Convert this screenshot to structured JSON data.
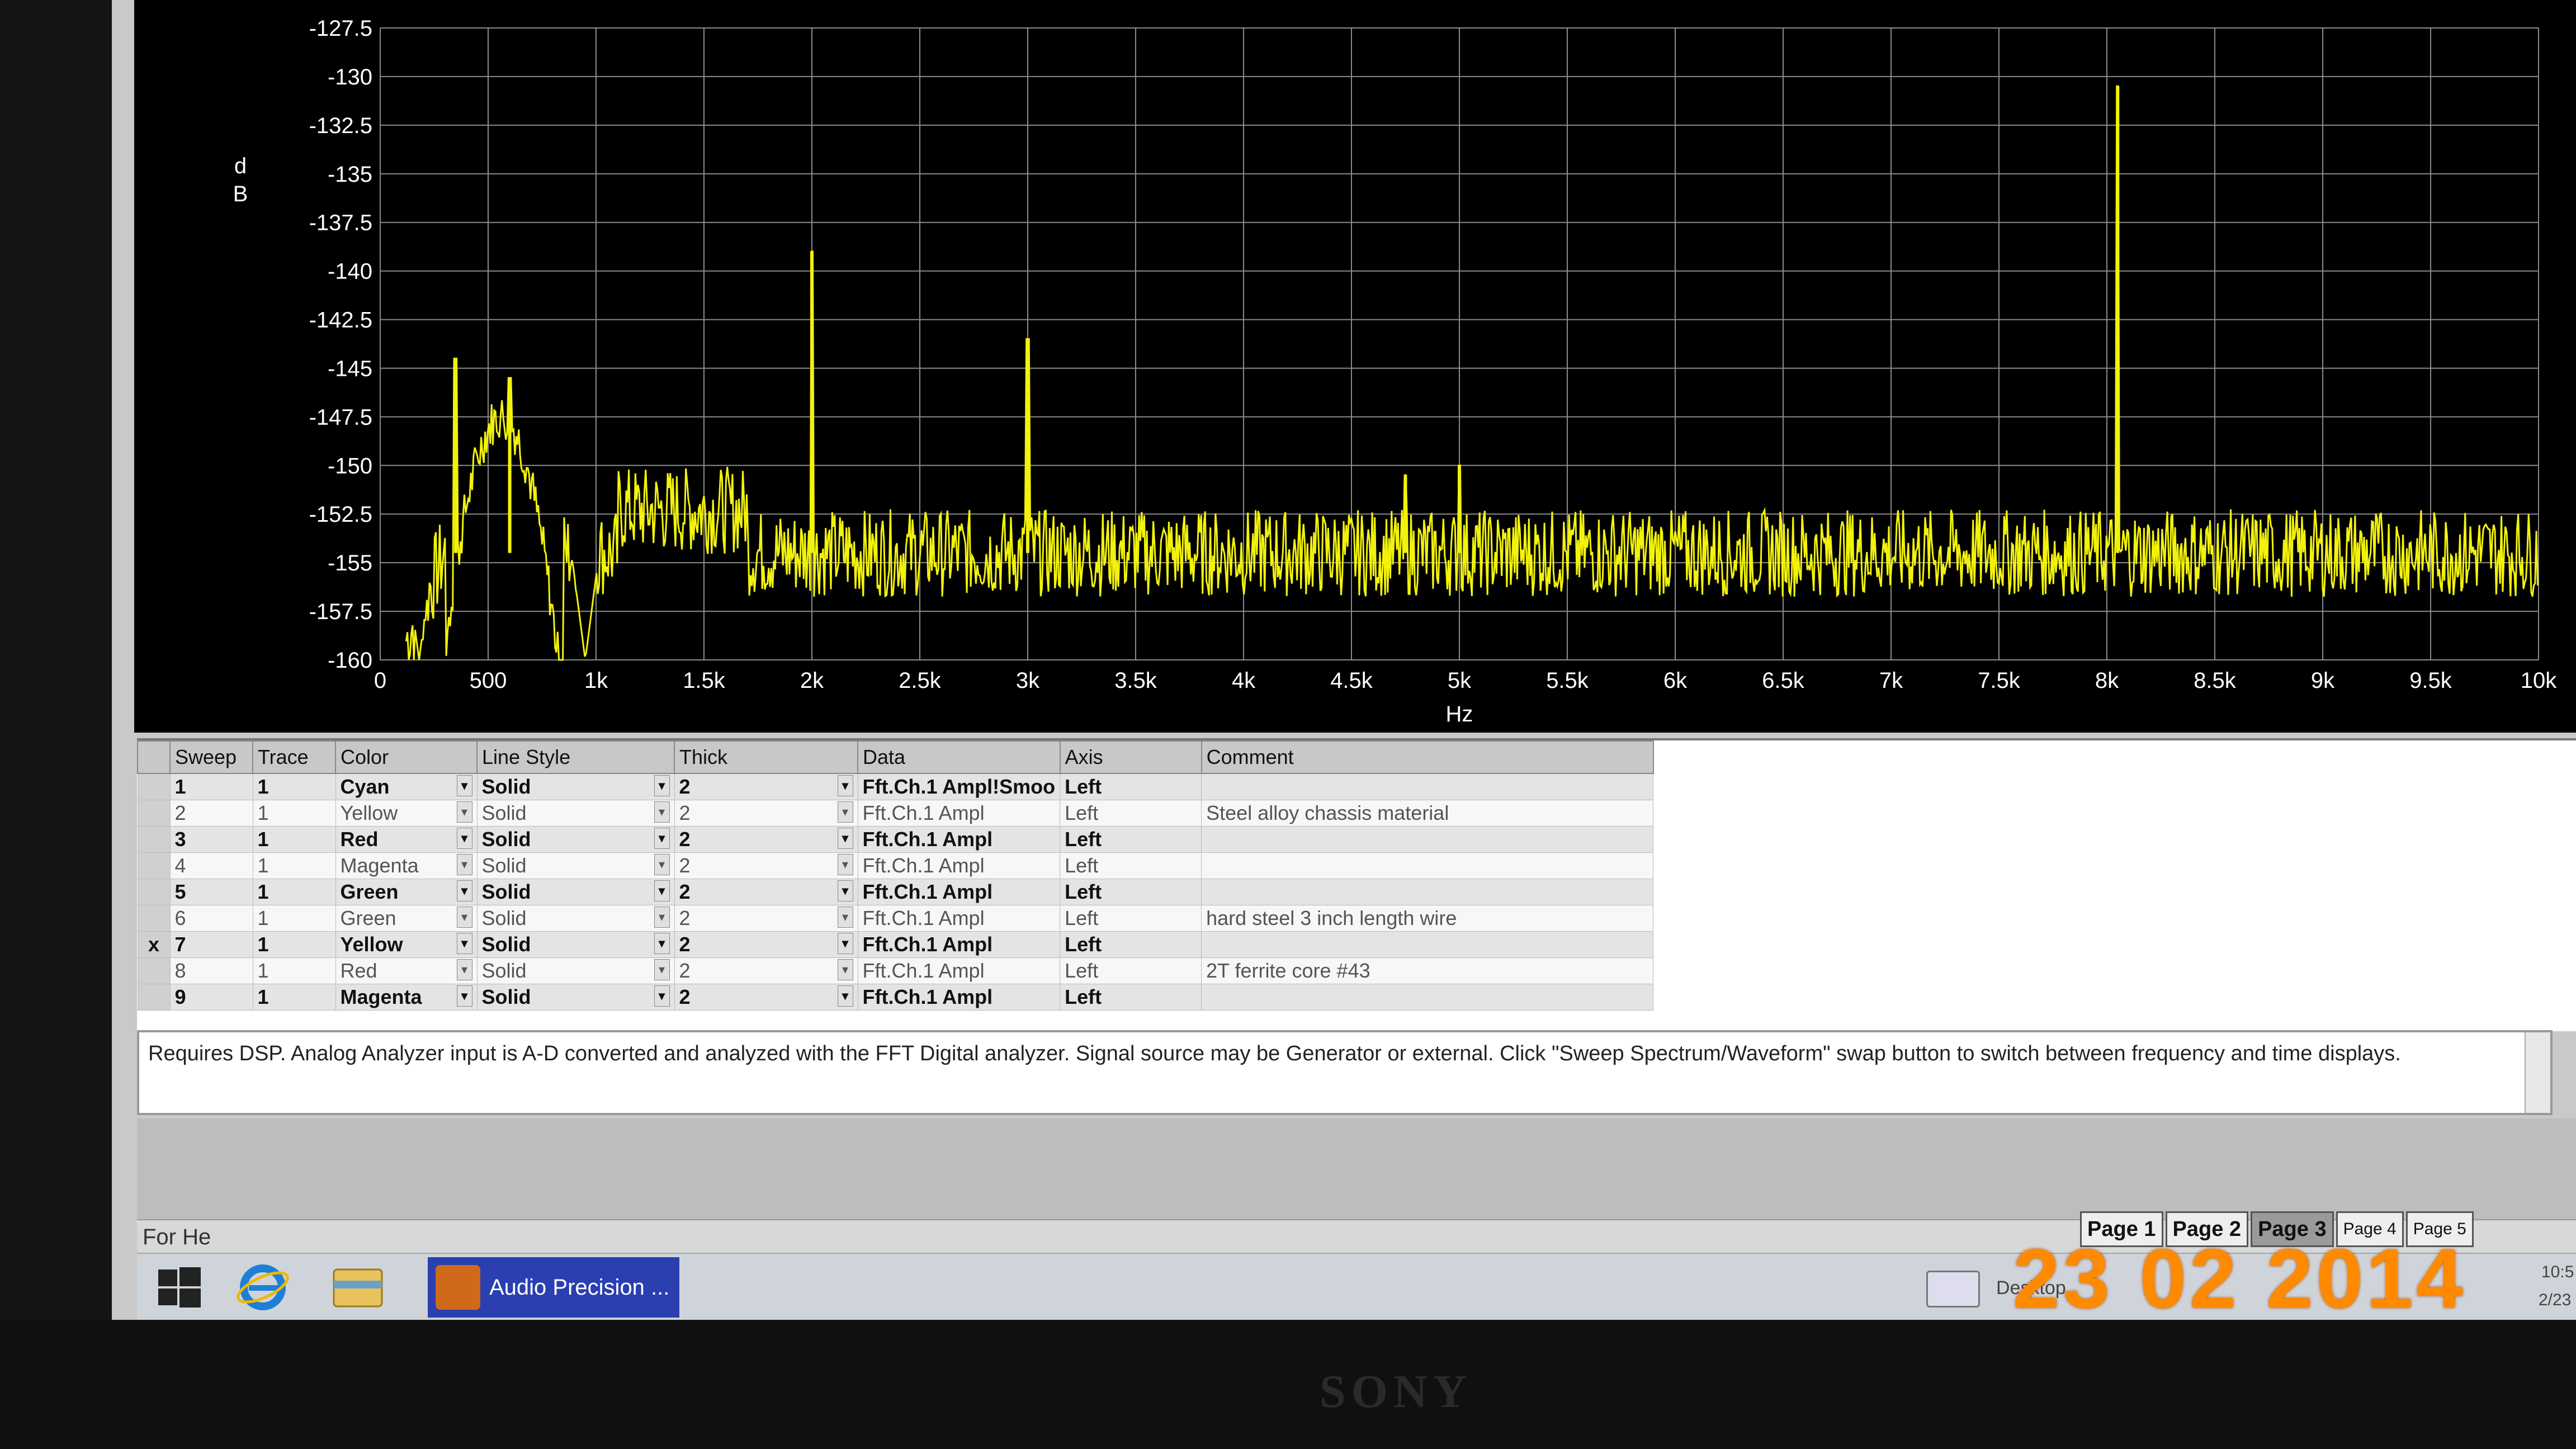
{
  "chart_data": {
    "type": "line",
    "ylabel": "dB",
    "xlabel": "Hz",
    "ylim": [
      -160,
      -127.5
    ],
    "xlim": [
      0,
      10000
    ],
    "y_ticks": [
      "-127.5",
      "-130",
      "-132.5",
      "-135",
      "-137.5",
      "-140",
      "-142.5",
      "-145",
      "-147.5",
      "-150",
      "-152.5",
      "-155",
      "-157.5",
      "-160"
    ],
    "x_ticks": [
      "0",
      "500",
      "1k",
      "1.5k",
      "2k",
      "2.5k",
      "3k",
      "3.5k",
      "4k",
      "4.5k",
      "5k",
      "5.5k",
      "6k",
      "6.5k",
      "7k",
      "7.5k",
      "8k",
      "8.5k",
      "9k",
      "9.5k",
      "10k"
    ],
    "grid": true,
    "series": [
      {
        "color": "#f2f20a",
        "noise_floor_db": -154.5,
        "peaks": [
          {
            "x": 350,
            "y": -144.5
          },
          {
            "x": 600,
            "y": -145.5
          },
          {
            "x": 2000,
            "y": -139.0
          },
          {
            "x": 3000,
            "y": -143.5
          },
          {
            "x": 4750,
            "y": -150.5
          },
          {
            "x": 5000,
            "y": -150.0
          },
          {
            "x": 8050,
            "y": -130.5
          }
        ],
        "dips": [
          {
            "x": 180,
            "y": -160
          },
          {
            "x": 950,
            "y": -160
          }
        ]
      }
    ]
  },
  "table": {
    "headers": [
      "Sweep",
      "Trace",
      "Color",
      "Line Style",
      "Thick",
      "Data",
      "Axis",
      "Comment"
    ],
    "rows": [
      {
        "checked": "",
        "sweep": "1",
        "trace": "1",
        "color": "Cyan",
        "style": "Solid",
        "thick": "2",
        "data": "Fft.Ch.1 Ampl!Smoo",
        "axis": "Left",
        "comment": ""
      },
      {
        "checked": "",
        "sweep": "2",
        "trace": "1",
        "color": "Yellow",
        "style": "Solid",
        "thick": "2",
        "data": "Fft.Ch.1 Ampl",
        "axis": "Left",
        "comment": "Steel alloy chassis material"
      },
      {
        "checked": "",
        "sweep": "3",
        "trace": "1",
        "color": "Red",
        "style": "Solid",
        "thick": "2",
        "data": "Fft.Ch.1 Ampl",
        "axis": "Left",
        "comment": ""
      },
      {
        "checked": "",
        "sweep": "4",
        "trace": "1",
        "color": "Magenta",
        "style": "Solid",
        "thick": "2",
        "data": "Fft.Ch.1 Ampl",
        "axis": "Left",
        "comment": ""
      },
      {
        "checked": "",
        "sweep": "5",
        "trace": "1",
        "color": "Green",
        "style": "Solid",
        "thick": "2",
        "data": "Fft.Ch.1 Ampl",
        "axis": "Left",
        "comment": ""
      },
      {
        "checked": "",
        "sweep": "6",
        "trace": "1",
        "color": "Green",
        "style": "Solid",
        "thick": "2",
        "data": "Fft.Ch.1 Ampl",
        "axis": "Left",
        "comment": "hard steel 3 inch length wire"
      },
      {
        "checked": "x",
        "sweep": "7",
        "trace": "1",
        "color": "Yellow",
        "style": "Solid",
        "thick": "2",
        "data": "Fft.Ch.1 Ampl",
        "axis": "Left",
        "comment": ""
      },
      {
        "checked": "",
        "sweep": "8",
        "trace": "1",
        "color": "Red",
        "style": "Solid",
        "thick": "2",
        "data": "Fft.Ch.1 Ampl",
        "axis": "Left",
        "comment": "2T ferrite core #43"
      },
      {
        "checked": "",
        "sweep": "9",
        "trace": "1",
        "color": "Magenta",
        "style": "Solid",
        "thick": "2",
        "data": "Fft.Ch.1 Ampl",
        "axis": "Left",
        "comment": ""
      }
    ]
  },
  "info": {
    "text": "Requires DSP.  Analog Analyzer input is A-D converted and analyzed with the FFT Digital analyzer.  Signal source may be Generator or external.  Click \"Sweep Spectrum/Waveform\" swap button to switch between frequency and time displays."
  },
  "status": {
    "text": "For He"
  },
  "pages": [
    "Page 1",
    "Page 2",
    "Page 3",
    "Page 4",
    "Page 5"
  ],
  "taskbar": {
    "app_label": "Audio Precision ...",
    "desktop_label": "Desktop",
    "clock_time": "10:5",
    "clock_date": "2/23"
  },
  "camera_date": "23 02 2014",
  "brand": "SONY"
}
